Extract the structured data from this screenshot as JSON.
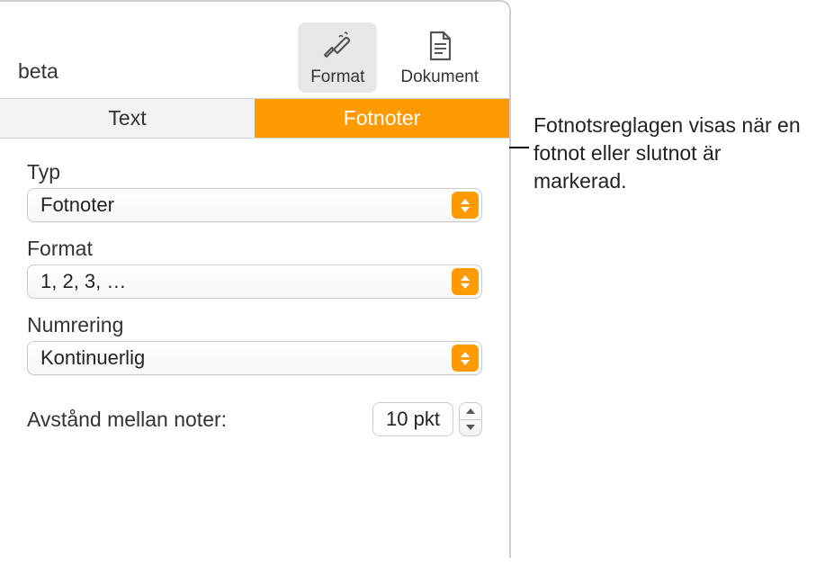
{
  "toolbar": {
    "left_text": "beta",
    "format_button": "Format",
    "document_button": "Dokument"
  },
  "tabs": {
    "text": "Text",
    "footnotes": "Fotnoter"
  },
  "fields": {
    "type": {
      "label": "Typ",
      "value": "Fotnoter"
    },
    "format": {
      "label": "Format",
      "value": "1, 2, 3, …"
    },
    "numbering": {
      "label": "Numrering",
      "value": "Kontinuerlig"
    },
    "spacing": {
      "label": "Avstånd mellan noter:",
      "value": "10 pkt"
    }
  },
  "callout": {
    "text": "Fotnotsreglagen visas när en fotnot eller slutnot är markerad."
  }
}
